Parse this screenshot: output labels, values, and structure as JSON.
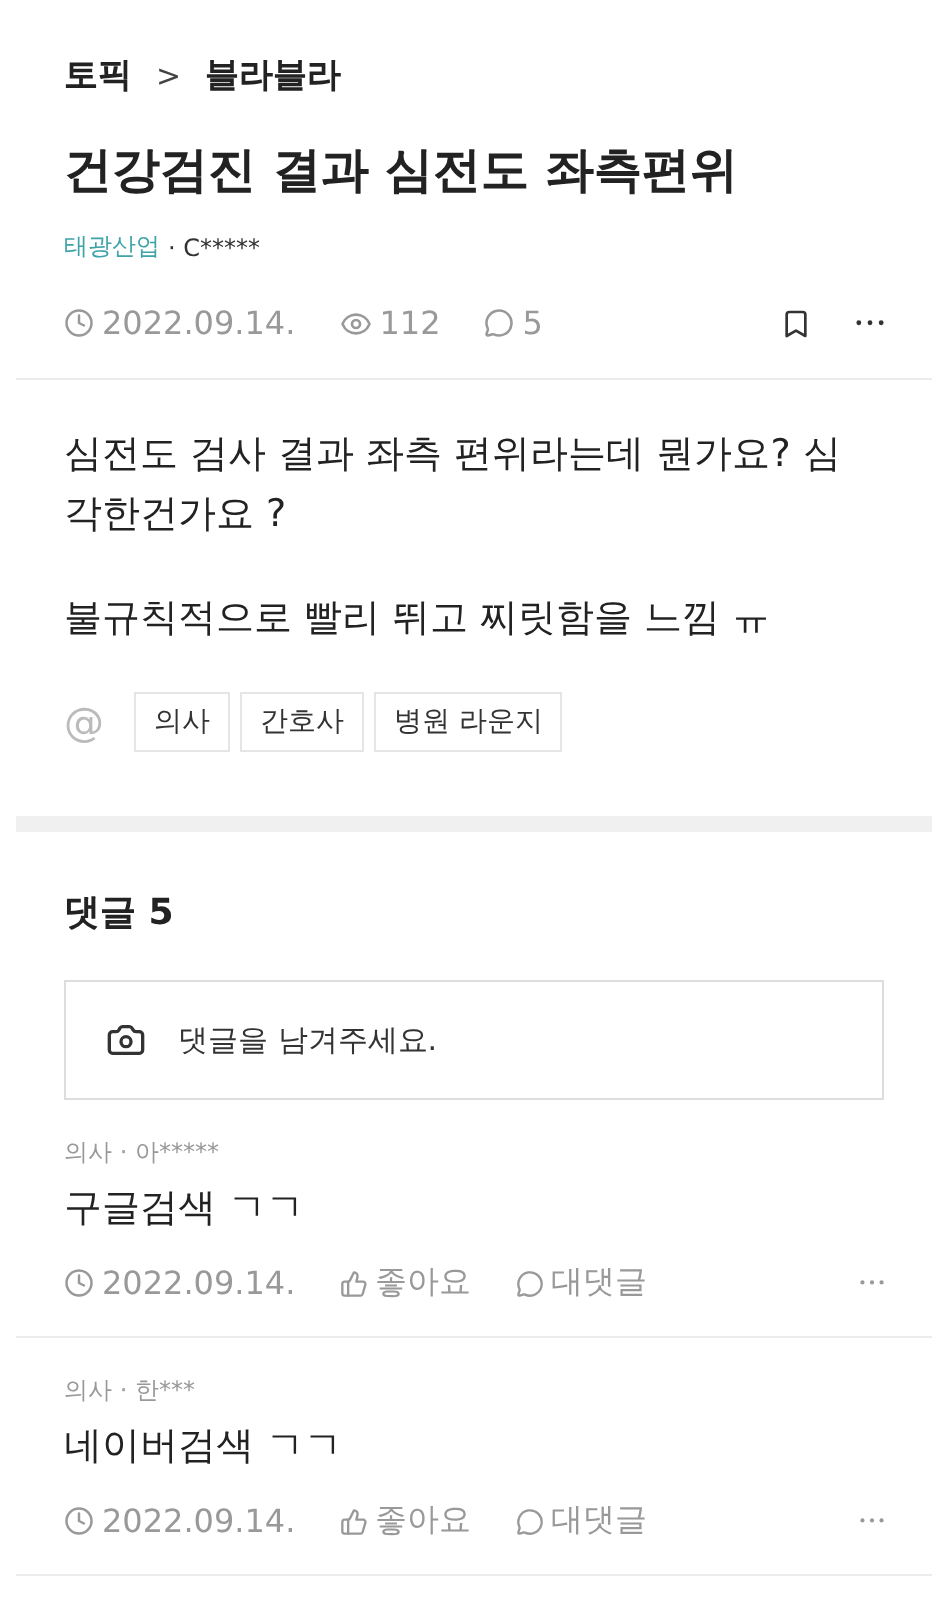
{
  "breadcrumb": {
    "topic": "토픽",
    "separator": ">",
    "board": "블라블라"
  },
  "post": {
    "title": "건강검진 결과 심전도 좌측편위",
    "company": "태광산업",
    "author": "· C*****",
    "date": "2022.09.14.",
    "views": "112",
    "comments": "5",
    "body": [
      "심전도 검사 결과 좌측 편위라는데 뭔가요? 심각한건가요 ?",
      "불규칙적으로 빨리 뛰고 찌릿함을 느낌 ㅠ"
    ],
    "mention_symbol": "@",
    "tags": [
      "의사",
      "간호사",
      "병원 라운지"
    ]
  },
  "comments_section": {
    "heading": "댓글 5",
    "input": {
      "placeholder": "댓글을 남겨주세요."
    },
    "comments": [
      {
        "author": "의사 · 아*****",
        "text": "구글검색 ㄱㄱ",
        "date": "2022.09.14.",
        "like": "좋아요",
        "reply": "대댓글"
      },
      {
        "author": "의사 · 한***",
        "text": "네이버검색 ㄱㄱ",
        "date": "2022.09.14.",
        "like": "좋아요",
        "reply": "대댓글"
      }
    ]
  }
}
